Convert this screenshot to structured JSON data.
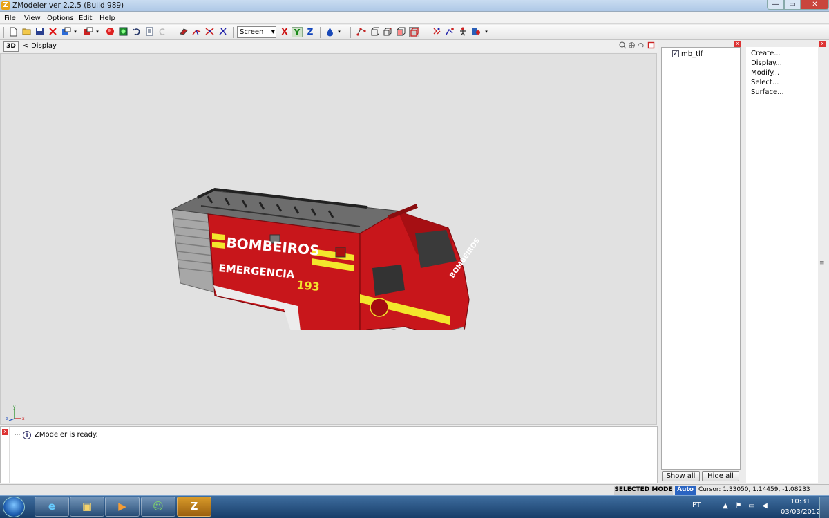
{
  "window": {
    "title": "ZModeler ver 2.2.5 (Build 989)",
    "app_icon": "Z",
    "min_glyph": "—",
    "max_glyph": "▭",
    "close_glyph": "✕"
  },
  "menu": {
    "items": [
      "File",
      "View",
      "Options",
      "Edit",
      "Help"
    ]
  },
  "toolbar": {
    "view_mode": "Screen",
    "axis_x": "X",
    "axis_y": "Y",
    "axis_z": "Z"
  },
  "viewport": {
    "mode_button": "3D",
    "collapse_glyph": "<",
    "title": "Display",
    "model": {
      "side_text": "BOMBEIROS",
      "emergency_text": "EMERGENCIA",
      "number_text": "193",
      "hood_text": "BOMBEIROS"
    },
    "axis_labels": {
      "x": "x",
      "y": "y",
      "z": "z"
    }
  },
  "log": {
    "message": "ZModeler is ready.",
    "info_glyph": "i",
    "close_glyph": "x",
    "tree_dots": "..."
  },
  "object_tree": {
    "items": [
      {
        "label": "mb_tlf",
        "checked": true,
        "check_glyph": "✓"
      }
    ],
    "show_all": "Show all",
    "hide_all": "Hide all",
    "close_glyph": "x"
  },
  "commands": {
    "items": [
      "Create...",
      "Display...",
      "Modify...",
      "Select...",
      "Surface..."
    ],
    "close_glyph": "x",
    "grip_glyph": "≡"
  },
  "status": {
    "mode": "SELECTED MODE",
    "snap": "Auto",
    "cursor": "Cursor: 1.33050, 1.14459, -1.08233"
  },
  "taskbar": {
    "apps": [
      "ie-icon",
      "folder-icon",
      "media-icon",
      "messenger-icon",
      "zmodeler-icon"
    ],
    "app_glyphs": [
      "e",
      "▣",
      "▶",
      "☺",
      "Z"
    ],
    "tray_lang": "PT",
    "tray_glyphs": [
      "▲",
      "⚑",
      "▭",
      "◀"
    ],
    "clock_time": "10:31",
    "clock_date": "03/03/2012"
  },
  "colors": {
    "truck_red": "#c8161b",
    "stripe_yellow": "#f3e62c",
    "viewport_bg": "#e1e1e1",
    "snap_blue": "#2a64c2"
  }
}
